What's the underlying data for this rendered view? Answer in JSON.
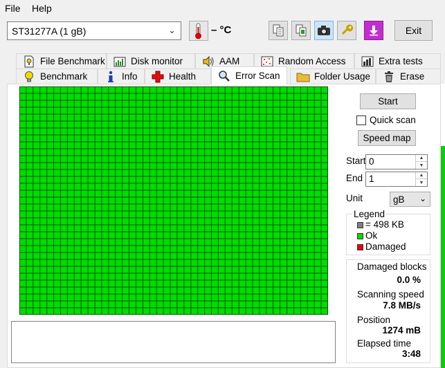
{
  "menu": {
    "file": "File",
    "help": "Help"
  },
  "toolbar": {
    "drive": "ST31277A (1 gB)",
    "temperature": "– °C",
    "exit_label": "Exit",
    "icons": [
      "copy-text-icon",
      "copy-screenshot-icon",
      "camera-icon",
      "wrench-icon",
      "save-down-icon"
    ]
  },
  "tabs": {
    "row1": [
      "File Benchmark",
      "Disk monitor",
      "AAM",
      "Random Access",
      "Extra tests"
    ],
    "row2": [
      "Benchmark",
      "Info",
      "Health",
      "Error Scan",
      "Folder Usage",
      "Erase"
    ],
    "selected": "Error Scan"
  },
  "scan": {
    "start_button": "Start",
    "quick_scan_label": "Quick scan",
    "quick_scan_checked": false,
    "speed_map_button": "Speed map",
    "start_label": "Start",
    "start_value": "0",
    "end_label": "End",
    "end_value": "1",
    "unit_label": "Unit",
    "unit_value": "gB"
  },
  "legend": {
    "title": "Legend",
    "block_size": "= 498 KB",
    "ok": "Ok",
    "damaged": "Damaged"
  },
  "stats": {
    "damaged_blocks_label": "Damaged blocks",
    "damaged_blocks_value": "0.0 %",
    "scanning_speed_label": "Scanning speed",
    "scanning_speed_value": "7.8 MB/s",
    "position_label": "Position",
    "position_value": "1274 mB",
    "elapsed_label": "Elapsed time",
    "elapsed_value": "3:48"
  },
  "colors": {
    "ok": "#00dd00",
    "damaged": "#ee0000",
    "untested": "#808080",
    "grid_line": "#005500"
  },
  "block_grid": {
    "columns": 45,
    "rows": 33,
    "status": "ok"
  }
}
